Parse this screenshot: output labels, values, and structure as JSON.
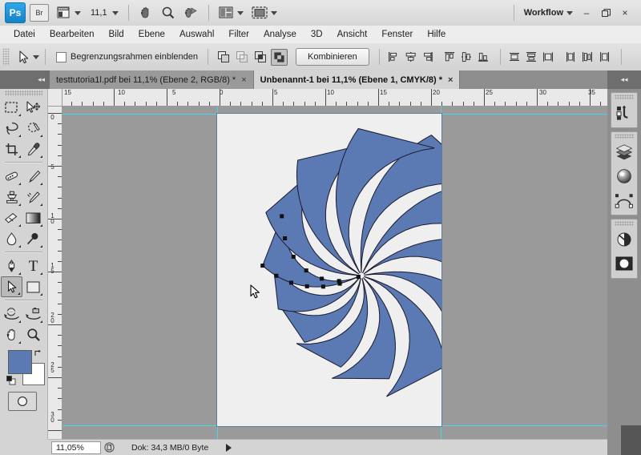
{
  "app": {
    "name": "Photoshop",
    "logo_text": "Ps",
    "bridge_label": "Br",
    "zoom_level": "11,1",
    "workspace_label": "Workflow",
    "window_buttons": {
      "minimize": "–",
      "restore": "❐",
      "close": "×"
    },
    "icons": {
      "bridge": "bridge-icon",
      "mini_bridge": "mini-bridge-icon",
      "hand": "hand-tool-icon",
      "zoom": "zoom-tool-icon",
      "rotate_view": "rotate-view-tool-icon",
      "arrange": "arrange-documents-icon",
      "screen_mode": "screen-mode-icon"
    }
  },
  "menubar": {
    "items": [
      {
        "label": "Datei"
      },
      {
        "label": "Bearbeiten"
      },
      {
        "label": "Bild"
      },
      {
        "label": "Ebene"
      },
      {
        "label": "Auswahl"
      },
      {
        "label": "Filter"
      },
      {
        "label": "Analyse"
      },
      {
        "label": "3D"
      },
      {
        "label": "Ansicht"
      },
      {
        "label": "Fenster"
      },
      {
        "label": "Hilfe"
      }
    ]
  },
  "options_bar": {
    "active_tool": "direct-selection-tool",
    "show_bounding_box_label": "Begrenzungsrahmen einblenden",
    "show_bounding_box_checked": false,
    "path_operations": [
      {
        "name": "add-to-shape-area",
        "selected": false
      },
      {
        "name": "subtract-from-shape-area",
        "selected": false
      },
      {
        "name": "intersect-shape-areas",
        "selected": false
      },
      {
        "name": "exclude-overlapping-shape-areas",
        "selected": true
      }
    ],
    "combine_label": "Kombinieren",
    "align_buttons": [
      "align-left-edges",
      "align-horizontal-centers",
      "align-right-edges",
      "align-top-edges",
      "align-vertical-centers",
      "align-bottom-edges",
      "distribute-top-edges",
      "distribute-vertical-centers",
      "distribute-bottom-edges",
      "distribute-left-edges",
      "distribute-horizontal-centers",
      "distribute-right-edges"
    ]
  },
  "tabs": {
    "collapse_label": "◂◂",
    "items": [
      {
        "title": "testtutoria1l.pdf bei 11,1% (Ebene 2, RGB/8) *",
        "active": false,
        "close": "×"
      },
      {
        "title": "Unbenannt-1 bei 11,1% (Ebene 1, CMYK/8) *",
        "active": true,
        "close": "×"
      }
    ],
    "right_collapse_label": "◂◂"
  },
  "toolbox": {
    "groups": [
      {
        "tools": [
          {
            "name": "rectangular-marquee-tool",
            "selected": false,
            "has_flyout": true
          },
          {
            "name": "move-tool",
            "selected": false,
            "has_flyout": false
          },
          {
            "name": "lasso-tool",
            "selected": false,
            "has_flyout": true
          },
          {
            "name": "quick-selection-tool",
            "selected": false,
            "has_flyout": true
          },
          {
            "name": "crop-tool",
            "selected": false,
            "has_flyout": true
          },
          {
            "name": "eyedropper-tool",
            "selected": false,
            "has_flyout": true
          }
        ]
      },
      {
        "tools": [
          {
            "name": "spot-healing-brush-tool",
            "selected": false,
            "has_flyout": true
          },
          {
            "name": "brush-tool",
            "selected": false,
            "has_flyout": true
          },
          {
            "name": "clone-stamp-tool",
            "selected": false,
            "has_flyout": true
          },
          {
            "name": "history-brush-tool",
            "selected": false,
            "has_flyout": true
          },
          {
            "name": "eraser-tool",
            "selected": false,
            "has_flyout": true
          },
          {
            "name": "gradient-tool",
            "selected": false,
            "has_flyout": true
          },
          {
            "name": "blur-tool",
            "selected": false,
            "has_flyout": true
          },
          {
            "name": "dodge-tool",
            "selected": false,
            "has_flyout": true
          }
        ]
      },
      {
        "tools": [
          {
            "name": "pen-tool",
            "selected": false,
            "has_flyout": true
          },
          {
            "name": "horizontal-type-tool",
            "selected": false,
            "has_flyout": true
          },
          {
            "name": "direct-selection-tool",
            "selected": true,
            "has_flyout": true
          },
          {
            "name": "rectangle-shape-tool",
            "selected": false,
            "has_flyout": true
          }
        ]
      },
      {
        "tools": [
          {
            "name": "3d-object-rotate-tool",
            "selected": false,
            "has_flyout": true
          },
          {
            "name": "3d-camera-rotate-tool",
            "selected": false,
            "has_flyout": true
          },
          {
            "name": "hand-tool",
            "selected": false,
            "has_flyout": true
          },
          {
            "name": "zoom-tool",
            "selected": false,
            "has_flyout": false
          }
        ]
      }
    ],
    "foreground_color": "#5b79b3",
    "background_color": "#ffffff",
    "swap_icon": "swap-colors-icon",
    "reset_icon": "default-colors-icon",
    "quickmask_icon": "quick-mask-mode-icon"
  },
  "rulers": {
    "unit": "cm",
    "horizontal_ticks": [
      "15",
      "10",
      "5",
      "0",
      "5",
      "10",
      "15",
      "20",
      "25",
      "30",
      "35"
    ],
    "vertical_ticks": [
      "0",
      "5",
      "10",
      "15",
      "20",
      "25",
      "30"
    ]
  },
  "canvas": {
    "document_title": "Unbenannt-1",
    "background": "#efeff0",
    "pasteboard": "#9a9a9a",
    "guide_color": "#46d4e6",
    "artwork": {
      "name": "swirl-vector-shape",
      "fill_color": "#5b79b3",
      "stroke_color": "#1a1a2e",
      "blade_count": 13,
      "description": "Radial swirl of tapered curved blades emanating from an off-center pivot"
    },
    "selected_path_anchors": 14,
    "cursor": "arrow-pointer"
  },
  "statusbar": {
    "zoom_value": "11,05%",
    "zoom_icon": "document-thumbnail-icon",
    "doc_info": "Dok: 34,3 MB/0 Byte",
    "expand_icon": "status-expand-arrow"
  },
  "dock": {
    "top_collapse": "◂◂",
    "groups": [
      {
        "buttons": [
          {
            "name": "history-panel-icon"
          }
        ]
      },
      {
        "buttons": [
          {
            "name": "layers-panel-icon"
          },
          {
            "name": "color-panel-icon"
          },
          {
            "name": "paths-panel-icon"
          }
        ]
      },
      {
        "buttons": [
          {
            "name": "adjustments-panel-icon"
          },
          {
            "name": "masks-panel-icon"
          }
        ]
      }
    ]
  },
  "colors": {
    "accent_blue": "#5b79b3",
    "guide_cyan": "#46d4e6",
    "chrome_gray": "#d4d4d4",
    "dark_chrome": "#8e8e8e"
  }
}
